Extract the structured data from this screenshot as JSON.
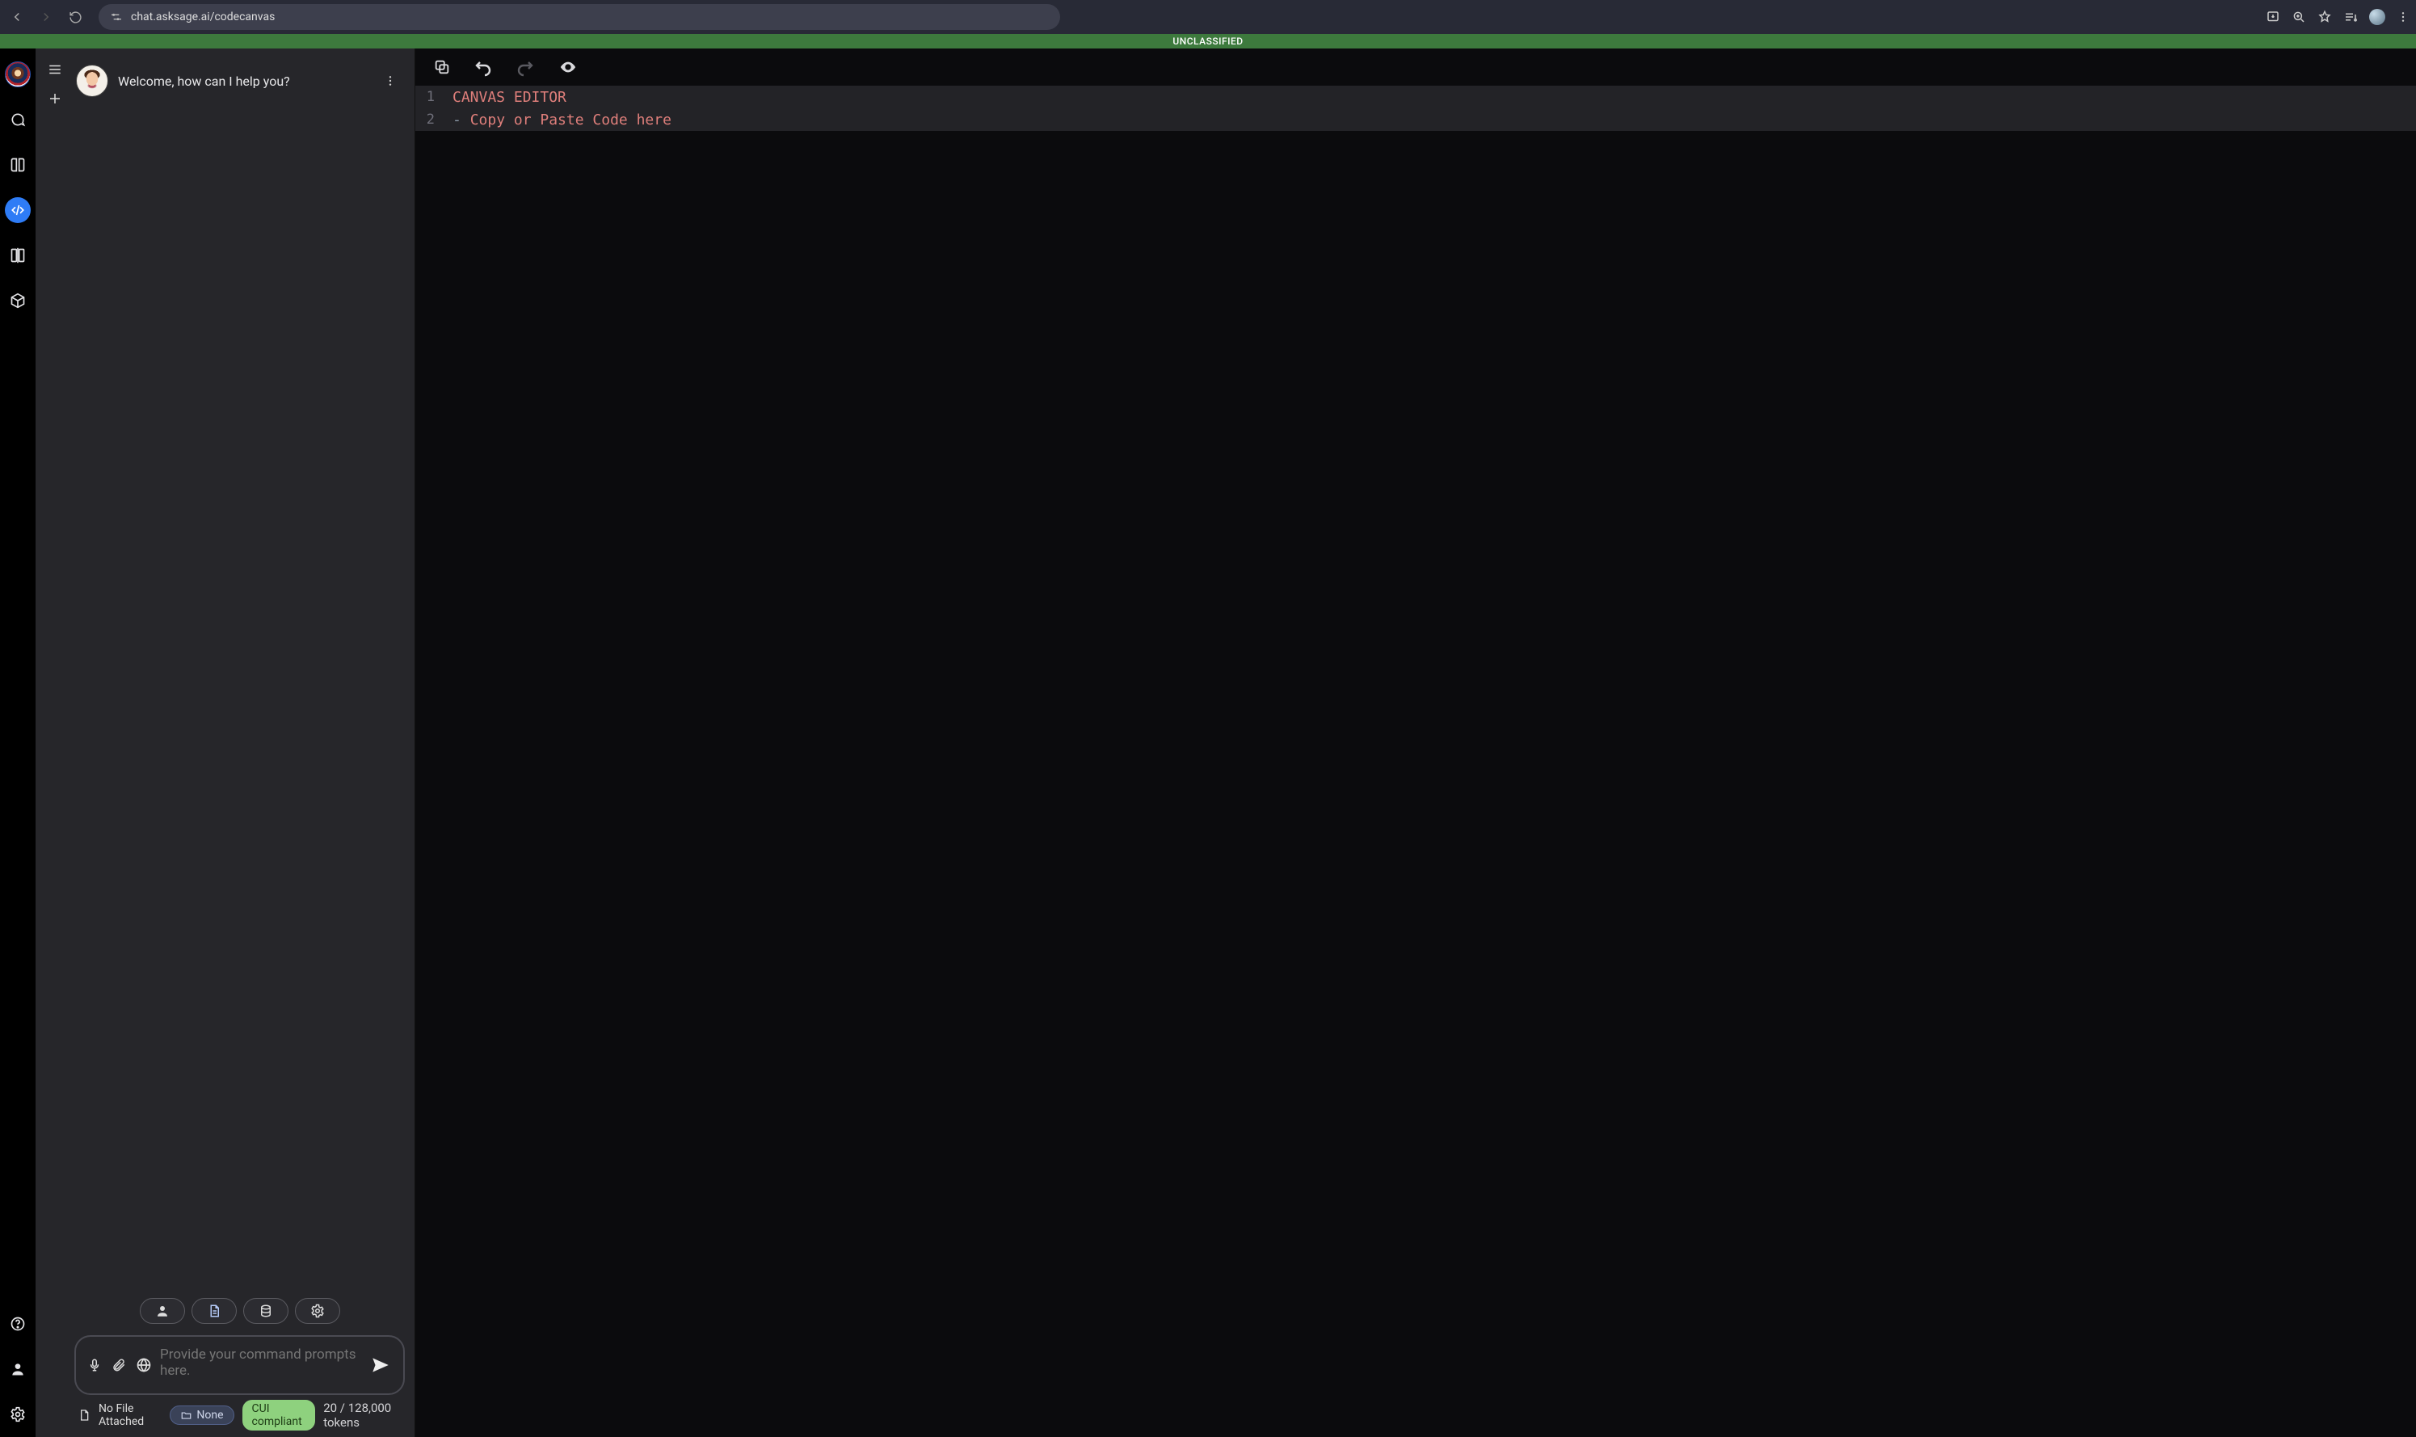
{
  "browser": {
    "url": "chat.asksage.ai/codecanvas"
  },
  "banner": "UNCLASSIFIED",
  "chat": {
    "welcome": "Welcome, how can I help you?",
    "prompt_placeholder": "Provide your command prompts here.",
    "status": {
      "file_label": "No File Attached",
      "folder_chip": "None",
      "compliance_chip": "CUI compliant",
      "tokens": "20 / 128,000 tokens"
    }
  },
  "editor": {
    "lines": [
      {
        "n": "1",
        "cls": "tok-salmon",
        "text": "CANVAS EDITOR"
      },
      {
        "n": "2",
        "cls": "tok-salmon",
        "prefix": "- ",
        "text": "Copy or Paste Code here"
      }
    ]
  }
}
